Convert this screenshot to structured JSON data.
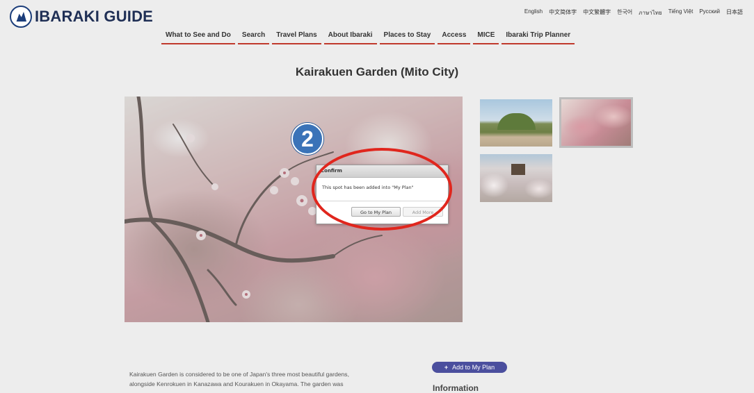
{
  "header": {
    "logo_text": "IBARAKI GUIDE",
    "languages": [
      "English",
      "中文简体字",
      "中文繁體字",
      "한국어",
      "ภาษาไทย",
      "Tiếng Việt",
      "Русский",
      "日本語"
    ],
    "nav": [
      "What to See and Do",
      "Search",
      "Travel Plans",
      "About Ibaraki",
      "Places to Stay",
      "Access",
      "MICE",
      "Ibaraki Trip Planner"
    ]
  },
  "page": {
    "title": "Kairakuen Garden (Mito City)"
  },
  "modal": {
    "title": "Confirm",
    "message": "This spot has been added into \"My Plan\"",
    "primary_button": "Go to My Plan",
    "secondary_button": "Add More"
  },
  "annotation": {
    "step_number": "2",
    "color": "#e0261d"
  },
  "content": {
    "description_lines": [
      "Kairakuen Garden is considered to be one of  Japan's three most beautiful gardens,",
      "alongside Kenrokuen in Kanazawa and Kourakuen in Okayama. The garden was"
    ],
    "add_button": "Add to My Plan",
    "info_heading": "Information"
  },
  "colors": {
    "nav_underline": "#c0392b",
    "add_button_bg": "#4b4f9e",
    "step_badge": "#3a73b8"
  }
}
